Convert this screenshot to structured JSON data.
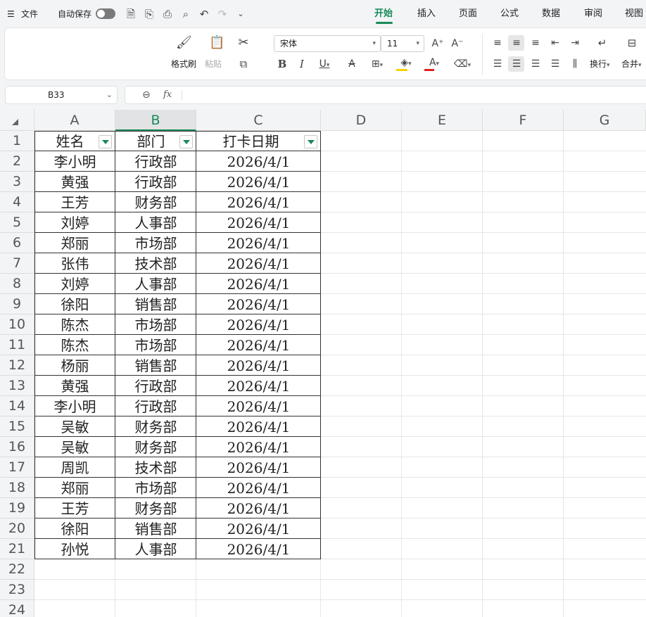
{
  "topbar": {
    "menu_label": "文件",
    "autosave_label": "自动保存",
    "tabs": [
      {
        "label": "开始",
        "active": true
      },
      {
        "label": "插入"
      },
      {
        "label": "页面"
      },
      {
        "label": "公式"
      },
      {
        "label": "数据"
      },
      {
        "label": "审阅"
      },
      {
        "label": "视图"
      }
    ]
  },
  "ribbon": {
    "format_painter": "格式刷",
    "paste": "粘贴",
    "font_name": "宋体",
    "font_size": "11",
    "wrap": "换行",
    "merge": "合并"
  },
  "formula_bar": {
    "name_box": "B33",
    "fx": "fx",
    "formula": ""
  },
  "sheet": {
    "columns": [
      "A",
      "B",
      "C",
      "D",
      "E",
      "F",
      "G"
    ],
    "selected_column": "B",
    "row_numbers": [
      "1",
      "2",
      "3",
      "4",
      "5",
      "6",
      "7",
      "8",
      "9",
      "10",
      "11",
      "12",
      "13",
      "14",
      "15",
      "16",
      "17",
      "18",
      "19",
      "20",
      "21",
      "22",
      "23",
      "24"
    ],
    "headers": [
      "姓名",
      "部门",
      "打卡日期"
    ],
    "rows": [
      [
        "李小明",
        "行政部",
        "2026/4/1"
      ],
      [
        "黄强",
        "行政部",
        "2026/4/1"
      ],
      [
        "王芳",
        "财务部",
        "2026/4/1"
      ],
      [
        "刘婷",
        "人事部",
        "2026/4/1"
      ],
      [
        "郑丽",
        "市场部",
        "2026/4/1"
      ],
      [
        "张伟",
        "技术部",
        "2026/4/1"
      ],
      [
        "刘婷",
        "人事部",
        "2026/4/1"
      ],
      [
        "徐阳",
        "销售部",
        "2026/4/1"
      ],
      [
        "陈杰",
        "市场部",
        "2026/4/1"
      ],
      [
        "陈杰",
        "市场部",
        "2026/4/1"
      ],
      [
        "杨丽",
        "销售部",
        "2026/4/1"
      ],
      [
        "黄强",
        "行政部",
        "2026/4/1"
      ],
      [
        "李小明",
        "行政部",
        "2026/4/1"
      ],
      [
        "吴敏",
        "财务部",
        "2026/4/1"
      ],
      [
        "吴敏",
        "财务部",
        "2026/4/1"
      ],
      [
        "周凯",
        "技术部",
        "2026/4/1"
      ],
      [
        "郑丽",
        "市场部",
        "2026/4/1"
      ],
      [
        "王芳",
        "财务部",
        "2026/4/1"
      ],
      [
        "徐阳",
        "销售部",
        "2026/4/1"
      ],
      [
        "孙悦",
        "人事部",
        "2026/4/1"
      ]
    ]
  },
  "colors": {
    "accent": "#1a8a5a",
    "font_color_bar": "#e02020",
    "fill_color_bar": "#f5d400"
  }
}
